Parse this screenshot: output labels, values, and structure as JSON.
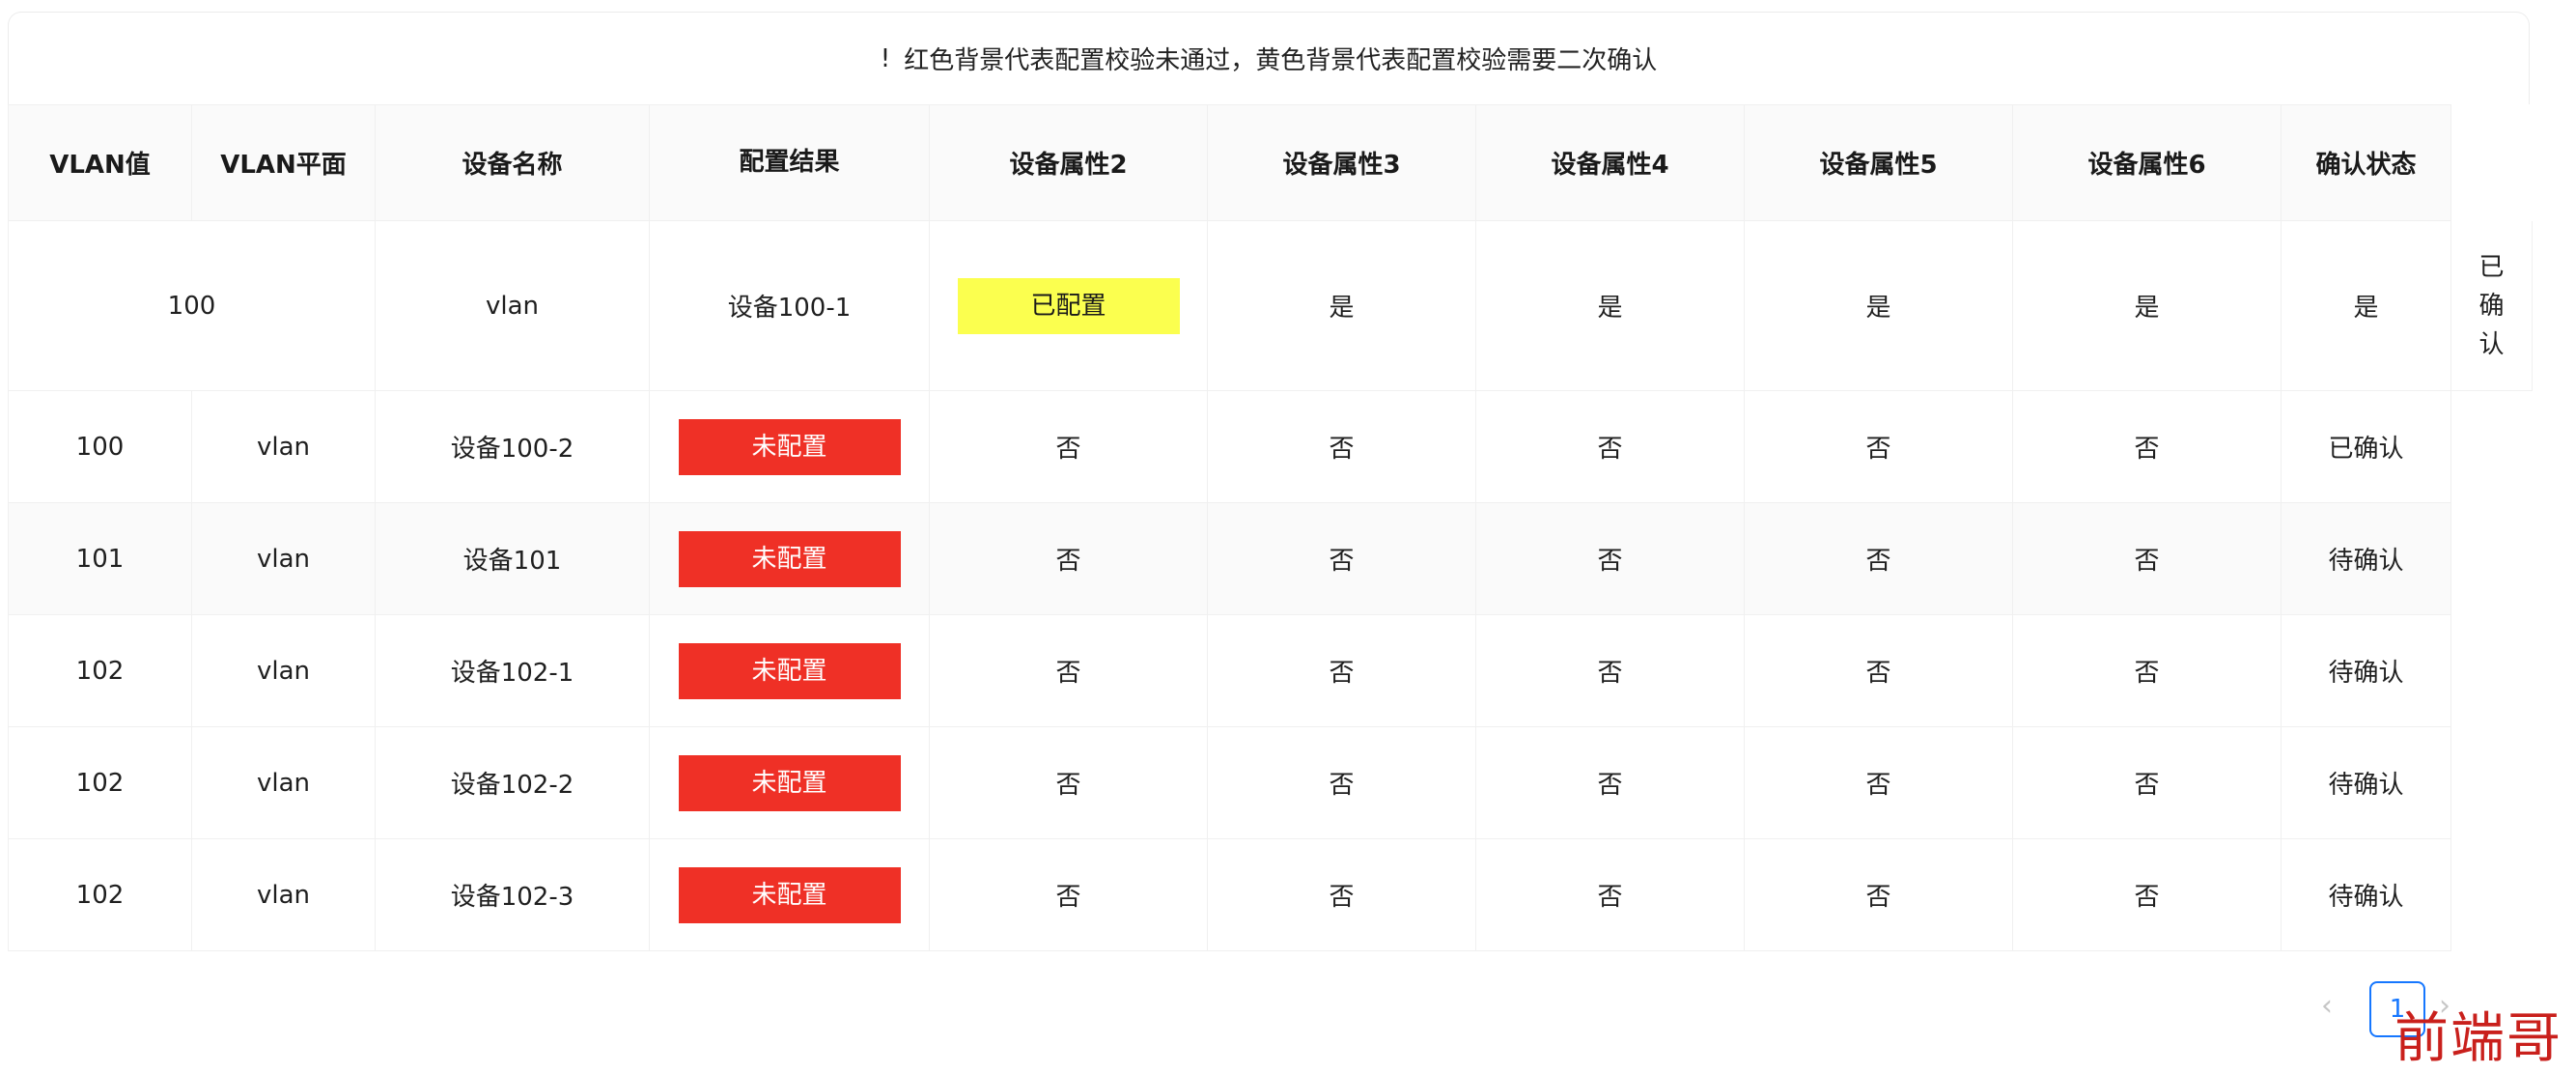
{
  "notice": {
    "mark": "!",
    "text": "红色背景代表配置校验未通过，黄色背景代表配置校验需要二次确认"
  },
  "table": {
    "headers": [
      "VLAN值",
      "VLAN平面",
      "设备名称",
      "配置结果",
      "设备属性2",
      "设备属性3",
      "设备属性4",
      "设备属性5",
      "设备属性6",
      "确认状态"
    ],
    "first_row": {
      "vlan_merged": "100",
      "plane": "vlan",
      "device": "设备100-1",
      "result": "已配置",
      "attrs": [
        "是",
        "是",
        "是",
        "是",
        "是"
      ],
      "extra": "已确认"
    },
    "rows": [
      {
        "vlan": "100",
        "plane": "vlan",
        "device": "设备100-2",
        "result": "未配置",
        "attrs": [
          "否",
          "否",
          "否",
          "否",
          "否"
        ],
        "status": "已确认"
      },
      {
        "vlan": "101",
        "plane": "vlan",
        "device": "设备101",
        "result": "未配置",
        "attrs": [
          "否",
          "否",
          "否",
          "否",
          "否"
        ],
        "status": "待确认"
      },
      {
        "vlan": "102",
        "plane": "vlan",
        "device": "设备102-1",
        "result": "未配置",
        "attrs": [
          "否",
          "否",
          "否",
          "否",
          "否"
        ],
        "status": "待确认"
      },
      {
        "vlan": "102",
        "plane": "vlan",
        "device": "设备102-2",
        "result": "未配置",
        "attrs": [
          "否",
          "否",
          "否",
          "否",
          "否"
        ],
        "status": "待确认"
      },
      {
        "vlan": "102",
        "plane": "vlan",
        "device": "设备102-3",
        "result": "未配置",
        "attrs": [
          "否",
          "否",
          "否",
          "否",
          "否"
        ],
        "status": "待确认"
      }
    ]
  },
  "colors": {
    "not_configured": "#ef3026",
    "needs_confirm": "#fbff4f",
    "accent": "#1677ff"
  },
  "pagination": {
    "prev_icon": "chevron-left-icon",
    "current_page": "1",
    "next_icon": "chevron-right-icon"
  },
  "watermark": {
    "text": "前端哥"
  }
}
